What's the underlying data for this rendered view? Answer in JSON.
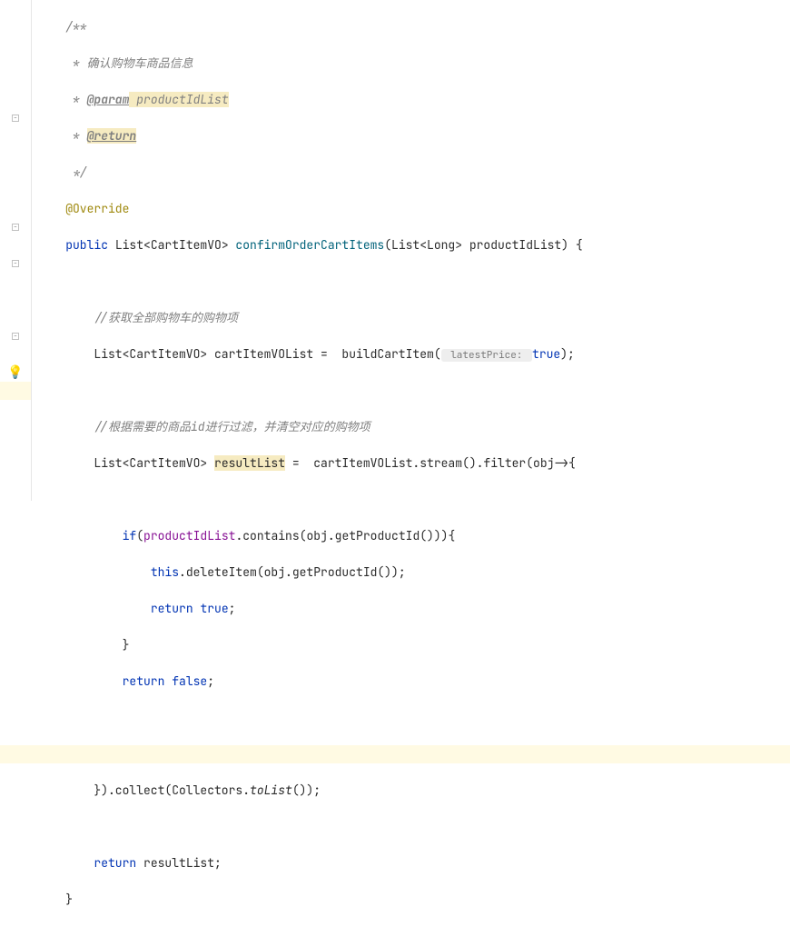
{
  "doc": {
    "open": "/**",
    "line1": " * 确认购物车商品信息",
    "line2_prefix": " * ",
    "param_tag": "@param",
    "param_name": " productIdList",
    "line3_prefix": " * ",
    "return_tag": "@return",
    "close": " */"
  },
  "annotation": "@Override",
  "sig": {
    "public": "public",
    "list1": " List<CartItemVO> ",
    "method": "confirmOrderCartItems",
    "params": "(List<Long> productIdList) {"
  },
  "c1": "//获取全部购物车的购物项",
  "l1": {
    "decl": "List<CartItemVO> cartItemVOList =  buildCartItem(",
    "hint": " latestPrice: ",
    "true": "true",
    "end": ");"
  },
  "c2": "//根据需要的商品id进行过滤，并清空对应的购物项",
  "l2": {
    "decl": "List<CartItemVO> ",
    "var": "resultList",
    "mid": " =  cartItemVOList.stream().filter(obj->{"
  },
  "l3": {
    "if": "if",
    "open": "(",
    "field": "productIdList",
    "rest": ".contains(obj.getProductId())){"
  },
  "l4": {
    "this": "this",
    "rest": ".deleteItem(obj.getProductId());"
  },
  "l5": {
    "return": "return",
    "sp": " ",
    "true": "true",
    "semi": ";"
  },
  "brace1": "}",
  "l6": {
    "return": "return",
    "sp": " ",
    "false": "false",
    "semi": ";"
  },
  "l7": {
    "close": "}).collect(Collectors.",
    "tolist": "toList",
    "end": "());"
  },
  "l8": {
    "return": "return",
    "sp": " ",
    "var": "resultList;"
  },
  "braceEnd": "}"
}
